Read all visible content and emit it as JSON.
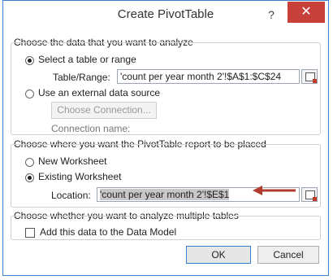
{
  "window": {
    "title": "Create PivotTable",
    "help_label": "?",
    "close_label": "✕"
  },
  "section1": {
    "heading": "Choose the data that you want to analyze",
    "option_select_range": "Select a table or range",
    "table_range_label": "Table/Range:",
    "table_range_value": "'count per year month 2'!$A$1:$C$24",
    "option_external": "Use an external data source",
    "choose_connection_label": "Choose Connection...",
    "connection_name_label": "Connection name:"
  },
  "section2": {
    "heading": "Choose where you want the PivotTable report to be placed",
    "option_new_worksheet": "New Worksheet",
    "option_existing_worksheet": "Existing Worksheet",
    "location_label": "Location:",
    "location_value": "'count per year month 2'!$E$1"
  },
  "section3": {
    "heading": "Choose whether you want to analyze multiple tables",
    "add_data_model_label": "Add this data to the Data Model"
  },
  "buttons": {
    "ok": "OK",
    "cancel": "Cancel"
  },
  "colors": {
    "accent": "#3a7fcf",
    "close_bg": "#c7403a",
    "arrow": "#b23b2e"
  },
  "icons": {
    "range_picker": "range-select-icon",
    "arrow": "red-arrow-annotation"
  }
}
